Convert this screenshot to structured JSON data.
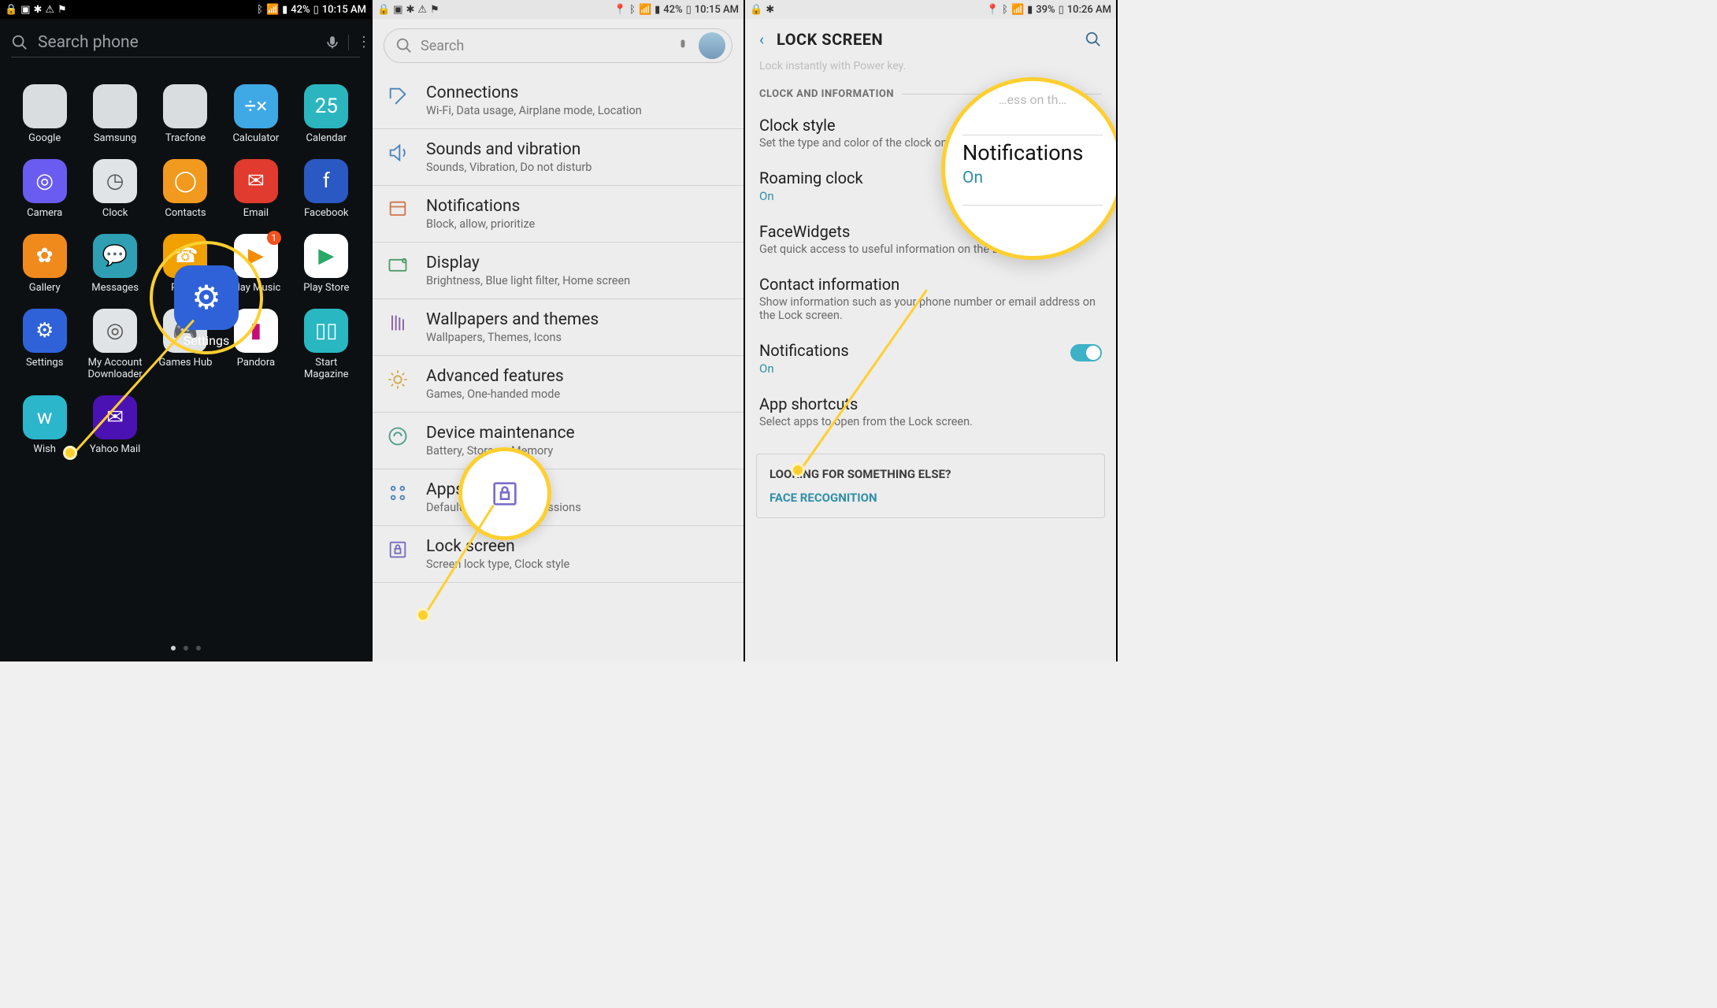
{
  "phone1": {
    "status": {
      "battery": "42%",
      "time": "10:15 AM"
    },
    "search_placeholder": "Search phone",
    "apps": [
      {
        "label": "Google",
        "kind": "folder"
      },
      {
        "label": "Samsung",
        "kind": "folder"
      },
      {
        "label": "Tracfone",
        "kind": "folder"
      },
      {
        "label": "Calculator",
        "bg": "#3fa9e6",
        "glyph": "÷×"
      },
      {
        "label": "Calendar",
        "bg": "#2bb6bf",
        "glyph": "25"
      },
      {
        "label": "Camera",
        "bg": "#6a5cf0",
        "glyph": "◎"
      },
      {
        "label": "Clock",
        "bg": "#e1e4e7",
        "glyph": "◷",
        "fg": "#555"
      },
      {
        "label": "Contacts",
        "bg": "#f29a1f",
        "glyph": "◯"
      },
      {
        "label": "Email",
        "bg": "#e03b2e",
        "glyph": "✉"
      },
      {
        "label": "Facebook",
        "bg": "#2b59c3",
        "glyph": "f"
      },
      {
        "label": "Gallery",
        "bg": "#f08a1d",
        "glyph": "✿"
      },
      {
        "label": "Messages",
        "bg": "#2f9fb4",
        "glyph": "💬"
      },
      {
        "label": "Phone",
        "bg": "#f0a000",
        "glyph": "☎"
      },
      {
        "label": "Play Music",
        "bg": "#ffffff",
        "glyph": "▶",
        "fg": "#f48c00",
        "badge": "1"
      },
      {
        "label": "Play Store",
        "bg": "#ffffff",
        "glyph": "▶",
        "fg": "#2aa866"
      },
      {
        "label": "Settings",
        "bg": "#2f62d9",
        "glyph": "⚙"
      },
      {
        "label": "My Account Downloader",
        "bg": "#e1e4e7",
        "glyph": "◎",
        "fg": "#555"
      },
      {
        "label": "Games Hub",
        "bg": "#e1e4e7",
        "glyph": "🎮",
        "fg": "#31a4d3"
      },
      {
        "label": "Pandora",
        "bg": "#ffffff",
        "glyph": "▮",
        "fg": "#c40e7a"
      },
      {
        "label": "Start Magazine",
        "bg": "#29b7c1",
        "glyph": "▯▯"
      },
      {
        "label": "Wish",
        "bg": "#2cb6cc",
        "glyph": "w"
      },
      {
        "label": "Yahoo Mail",
        "bg": "#4b12b3",
        "glyph": "✉"
      }
    ],
    "highlight_app_label": "Settings"
  },
  "phone2": {
    "status": {
      "battery": "42%",
      "time": "10:15 AM"
    },
    "search_placeholder": "Search",
    "rows": [
      {
        "title": "Connections",
        "sub": "Wi-Fi, Data usage, Airplane mode, Location",
        "icon": "connections"
      },
      {
        "title": "Sounds and vibration",
        "sub": "Sounds, Vibration, Do not disturb",
        "icon": "sound"
      },
      {
        "title": "Notifications",
        "sub": "Block, allow, prioritize",
        "icon": "notifications"
      },
      {
        "title": "Display",
        "sub": "Brightness, Blue light filter, Home screen",
        "icon": "display"
      },
      {
        "title": "Wallpapers and themes",
        "sub": "Wallpapers, Themes, Icons",
        "icon": "wallpaper"
      },
      {
        "title": "Advanced features",
        "sub": "Games, One-handed mode",
        "icon": "advanced"
      },
      {
        "title": "Device maintenance",
        "sub": "Battery, Storage, Memory",
        "icon": "device"
      },
      {
        "title": "Apps",
        "sub": "Default apps, App permissions",
        "icon": "apps"
      },
      {
        "title": "Lock screen",
        "sub": "Screen lock type, Clock style",
        "icon": "lock"
      }
    ],
    "highlight_row_title": "Lock screen"
  },
  "phone3": {
    "status": {
      "battery": "39%",
      "time": "10:26 AM"
    },
    "header_title": "LOCK SCREEN",
    "section_label": "CLOCK AND INFORMATION",
    "rows": [
      {
        "title": "Clock style",
        "sub": "Set the type and color of the clock on the Lock screen."
      },
      {
        "title": "Roaming clock",
        "val": "On",
        "toggle": true
      },
      {
        "title": "FaceWidgets",
        "sub": "Get quick access to useful information on the Lock screen."
      },
      {
        "title": "Contact information",
        "sub": "Show information such as your phone number or email address on the Lock screen."
      },
      {
        "title": "Notifications",
        "val": "On",
        "toggle": true
      },
      {
        "title": "App shortcuts",
        "sub": "Select apps to open from the Lock screen."
      }
    ],
    "help_q": "LOOKING FOR SOMETHING ELSE?",
    "help_a": "FACE RECOGNITION",
    "zoom_title": "Notifications",
    "zoom_val": "On",
    "zoom_ghost_top": "…ess on th…"
  }
}
